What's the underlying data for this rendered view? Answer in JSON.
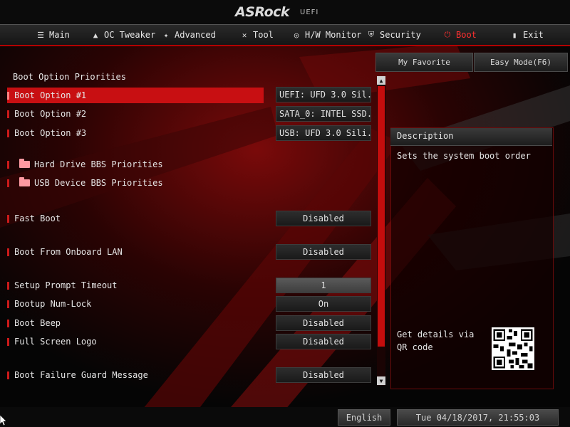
{
  "header": {
    "brand": "ASRock",
    "subtitle": "UEFI"
  },
  "tabs": [
    {
      "label": "Main",
      "icon": "list-icon"
    },
    {
      "label": "OC Tweaker",
      "icon": "rocket-icon"
    },
    {
      "label": "Advanced",
      "icon": "star-icon"
    },
    {
      "label": "Tool",
      "icon": "tools-icon"
    },
    {
      "label": "H/W Monitor",
      "icon": "monitor-icon"
    },
    {
      "label": "Security",
      "icon": "shield-icon"
    },
    {
      "label": "Boot",
      "icon": "power-icon",
      "active": true
    },
    {
      "label": "Exit",
      "icon": "exit-icon"
    }
  ],
  "buttons": {
    "favorite": "My Favorite",
    "easy_mode": "Easy Mode(F6)"
  },
  "section_title": "Boot Option Priorities",
  "options": {
    "boot1": {
      "label": "Boot Option #1",
      "value": "UEFI: UFD 3.0 Sil..."
    },
    "boot2": {
      "label": "Boot Option #2",
      "value": "SATA_0: INTEL SSD..."
    },
    "boot3": {
      "label": "Boot Option #3",
      "value": "USB: UFD 3.0 Sili..."
    },
    "hdd_bbs": {
      "label": "Hard Drive BBS Priorities"
    },
    "usb_bbs": {
      "label": "USB Device BBS Priorities"
    },
    "fast_boot": {
      "label": "Fast Boot",
      "value": "Disabled"
    },
    "onboard_lan": {
      "label": "Boot From Onboard LAN",
      "value": "Disabled"
    },
    "setup_timeout": {
      "label": "Setup Prompt Timeout",
      "value": "1"
    },
    "numlock": {
      "label": "Bootup Num-Lock",
      "value": "On"
    },
    "beep": {
      "label": "Boot Beep",
      "value": "Disabled"
    },
    "logo": {
      "label": "Full Screen Logo",
      "value": "Disabled"
    },
    "guard_msg": {
      "label": "Boot Failure Guard Message",
      "value": "Disabled"
    }
  },
  "description": {
    "title": "Description",
    "text": "Sets the system boot order",
    "qr_text": "Get details via QR code"
  },
  "footer": {
    "language": "English",
    "datetime": "Tue 04/18/2017, 21:55:03"
  },
  "colors": {
    "accent": "#c80f12",
    "active_tab": "#ff3030"
  }
}
